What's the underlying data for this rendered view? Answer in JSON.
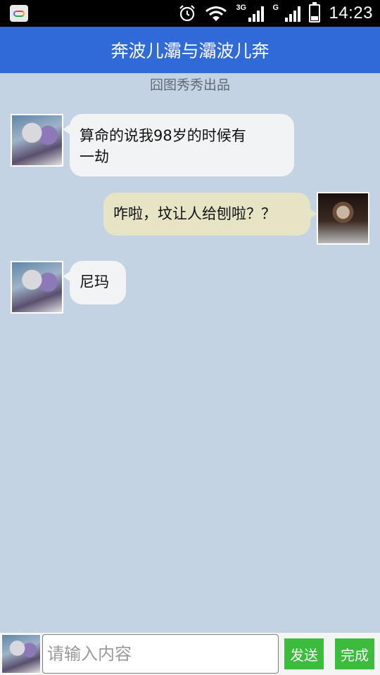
{
  "status_bar": {
    "time": "14:23",
    "network_1": "3G",
    "network_2": "G",
    "icons": [
      "app-icon",
      "alarm-icon",
      "wifi-icon",
      "signal-icon",
      "battery-icon"
    ]
  },
  "header": {
    "title": "奔波儿灞与灞波儿奔"
  },
  "credit": "囧图秀秀出品",
  "messages": [
    {
      "side": "left",
      "text_line1": "算命的说我98岁的时候有",
      "text_line2": "一劫"
    },
    {
      "side": "right",
      "text": "咋啦，坟让人给刨啦？？"
    },
    {
      "side": "left",
      "text": "尼玛"
    }
  ],
  "input_bar": {
    "placeholder": "请输入内容",
    "value": "",
    "send_label": "发送",
    "done_label": "完成"
  },
  "colors": {
    "title_bar": "#2f6ad8",
    "chat_background": "#c3d3e3",
    "left_bubble": "#f2f3f4",
    "right_bubble": "#e6e4c4",
    "button": "#3cbb3c"
  }
}
